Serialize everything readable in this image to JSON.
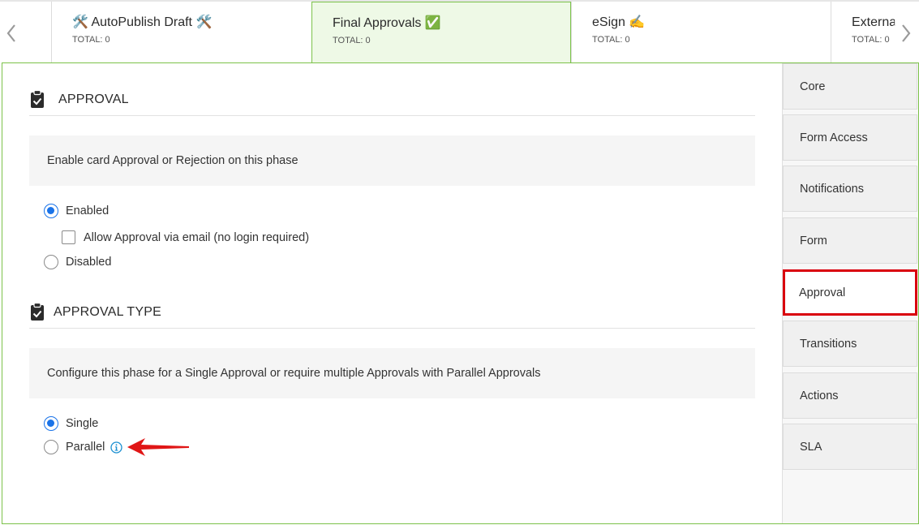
{
  "tabs": [
    {
      "title": "🛠️ AutoPublish Draft 🛠️",
      "total_label": "TOTAL:",
      "total_value": "0"
    },
    {
      "title": "Final Approvals ✅",
      "total_label": "TOTAL:",
      "total_value": "0"
    },
    {
      "title": "eSign ✍️",
      "total_label": "TOTAL:",
      "total_value": "0"
    },
    {
      "title": "External Sig",
      "total_label": "TOTAL:",
      "total_value": "0"
    }
  ],
  "approval_section": {
    "heading": "APPROVAL",
    "description": "Enable card Approval or Rejection on this phase",
    "options": {
      "enabled": "Enabled",
      "email_approval": "Allow Approval via email (no login required)",
      "disabled": "Disabled"
    },
    "selected": "Enabled",
    "email_approval_checked": false
  },
  "approval_type_section": {
    "heading": "APPROVAL TYPE",
    "description": "Configure this phase for a Single Approval or require multiple Approvals with Parallel Approvals",
    "options": {
      "single": "Single",
      "parallel": "Parallel"
    },
    "selected": "Single"
  },
  "sidebar": {
    "items": [
      {
        "label": "Core"
      },
      {
        "label": "Form Access"
      },
      {
        "label": "Notifications"
      },
      {
        "label": "Form"
      },
      {
        "label": "Approval"
      },
      {
        "label": "Transitions"
      },
      {
        "label": "Actions"
      },
      {
        "label": "SLA"
      }
    ],
    "active": "Approval"
  },
  "colors": {
    "accent_green": "#7cc24a",
    "active_tab_bg": "#eef9e6",
    "radio_blue": "#1a73e8",
    "highlight_red": "#d9000d",
    "info_blue": "#1a8fd1"
  },
  "icons": {
    "nav_prev": "chevron-left-icon",
    "nav_next": "chevron-right-icon",
    "section": "clipboard-check-icon",
    "info": "info-icon",
    "annotation": "red-arrow-icon"
  }
}
